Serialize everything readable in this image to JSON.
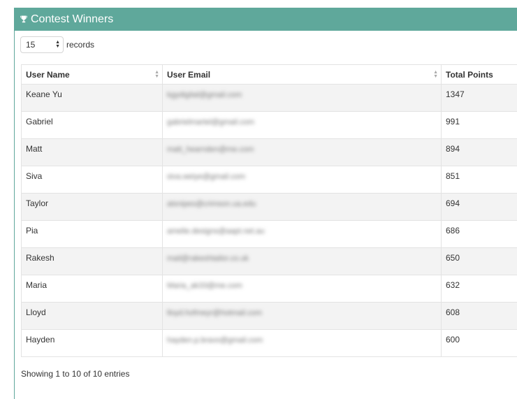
{
  "panel": {
    "title": "Contest Winners",
    "title_icon": "trophy-icon",
    "header_color": "#5fa89b"
  },
  "length_menu": {
    "selected": "15",
    "suffix": "records"
  },
  "table": {
    "columns": [
      "User Name",
      "User Email",
      "Total Points"
    ],
    "rows": [
      {
        "name": "Keane Yu",
        "email": "kgydigital@gmail.com",
        "points": "1347"
      },
      {
        "name": "Gabriel",
        "email": "gabrielmartel@gmail.com",
        "points": "991"
      },
      {
        "name": "Matt",
        "email": "matt_hearnden@me.com",
        "points": "894"
      },
      {
        "name": "Siva",
        "email": "siva.weiye@gmail.com",
        "points": "851"
      },
      {
        "name": "Taylor",
        "email": "atsnipes@crimson.ua.edu",
        "points": "694"
      },
      {
        "name": "Pia",
        "email": "amelie.designs@aapt.net.au",
        "points": "686"
      },
      {
        "name": "Rakesh",
        "email": "mail@rakeshtailor.co.uk",
        "points": "650"
      },
      {
        "name": "Maria",
        "email": "Maria_ak33@me.com",
        "points": "632"
      },
      {
        "name": "Lloyd",
        "email": "lloyd.hofmeyr@hotmail.com",
        "points": "608"
      },
      {
        "name": "Hayden",
        "email": "hayden.p.bravo@gmail.com",
        "points": "600"
      }
    ]
  },
  "info_text": "Showing 1 to 10 of 10 entries"
}
